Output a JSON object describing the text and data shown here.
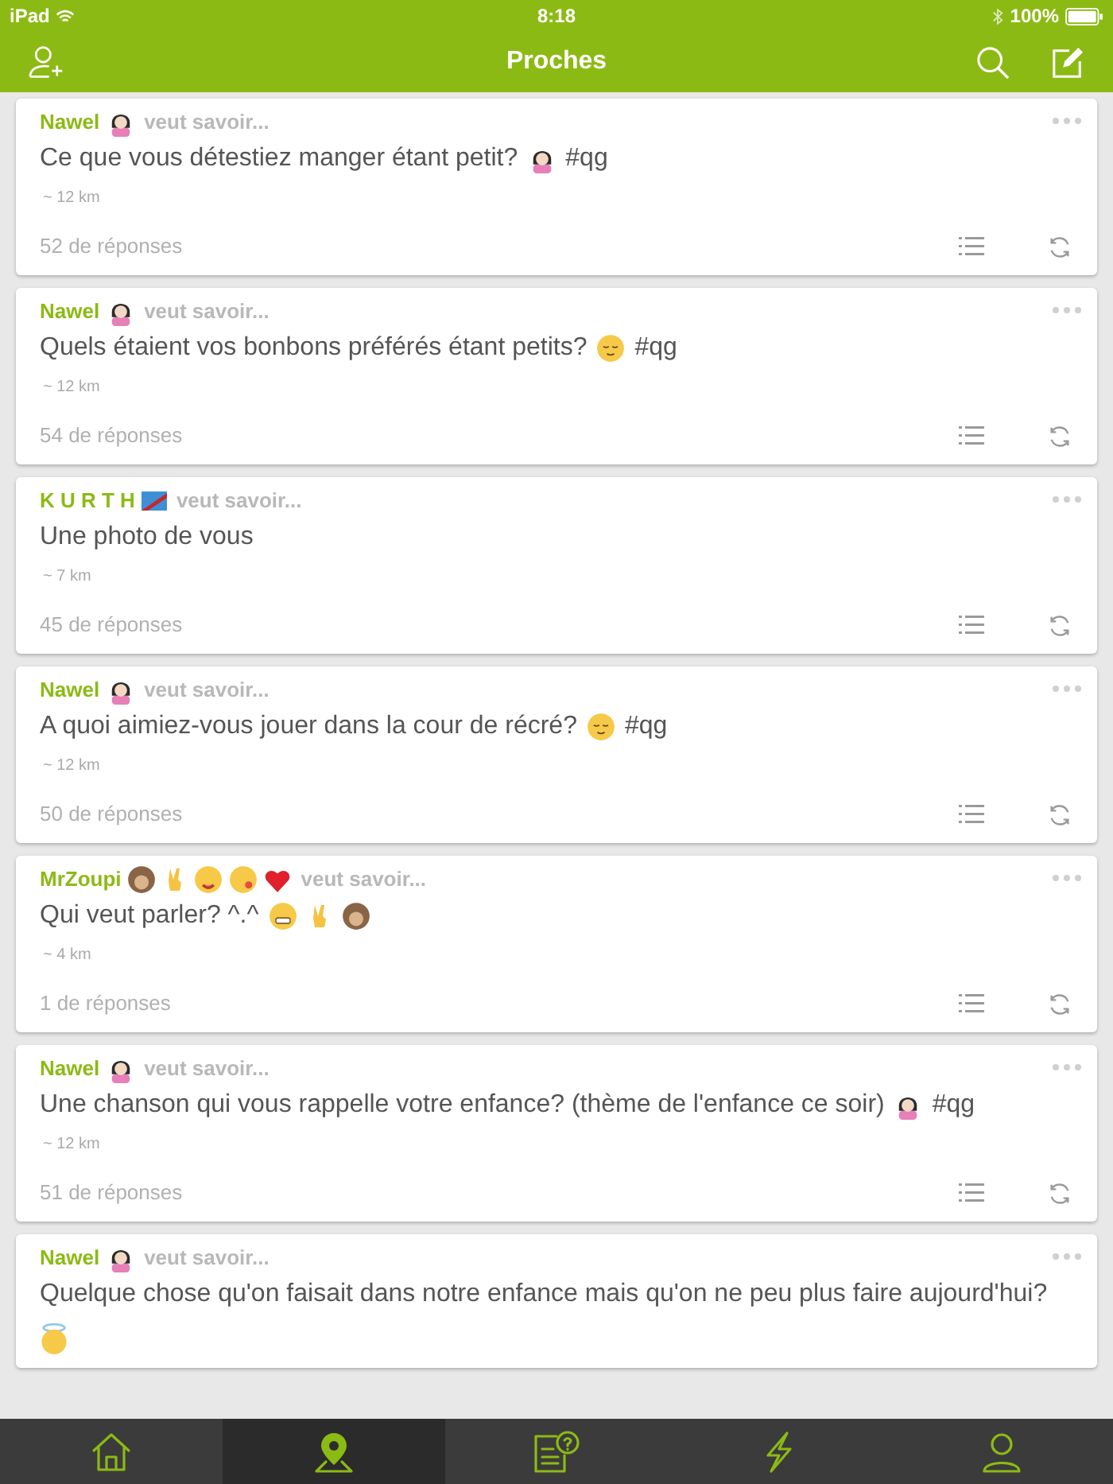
{
  "status_bar": {
    "carrier": "iPad",
    "time": "8:18",
    "battery": "100%"
  },
  "header": {
    "title": "Proches"
  },
  "questions": [
    {
      "author": "Nawel",
      "author_emojis": [
        {
          "kind": "girl"
        }
      ],
      "verb": "veut savoir...",
      "text": "Ce que vous détestiez manger étant petit?",
      "emojis": [
        {
          "kind": "girl"
        }
      ],
      "tag": "#qg",
      "distance": "~ 12 km",
      "replies": "52 de réponses"
    },
    {
      "author": "Nawel",
      "author_emojis": [
        {
          "kind": "girl"
        }
      ],
      "verb": "veut savoir...",
      "text": "Quels étaient vos bonbons préférés étant petits?",
      "emojis": [
        {
          "kind": "relieved"
        }
      ],
      "tag": "#qg",
      "distance": "~ 12 km",
      "replies": "54 de réponses"
    },
    {
      "author": "K U R T H",
      "author_emojis": [
        {
          "kind": "flag"
        }
      ],
      "verb": "veut savoir...",
      "text": "Une photo de vous",
      "distance": "~ 7 km",
      "replies": "45 de réponses"
    },
    {
      "author": "Nawel",
      "author_emojis": [
        {
          "kind": "girl"
        }
      ],
      "verb": "veut savoir...",
      "text": "A quoi aimiez-vous jouer dans la cour de récré?",
      "emojis": [
        {
          "kind": "relieved"
        }
      ],
      "tag": "#qg",
      "distance": "~ 12 km",
      "replies": "50 de réponses"
    },
    {
      "author": "MrZoupi",
      "author_emojis": [
        {
          "kind": "monkey"
        },
        {
          "kind": "victory"
        },
        {
          "kind": "wink"
        },
        {
          "kind": "kiss"
        },
        {
          "kind": "heart"
        }
      ],
      "verb": "veut savoir...",
      "text": "Qui veut parler? ^.^",
      "emojis": [
        {
          "kind": "grin"
        },
        {
          "kind": "victory"
        },
        {
          "kind": "monkey"
        }
      ],
      "distance": "~ 4 km",
      "replies": "1 de réponses"
    },
    {
      "author": "Nawel",
      "author_emojis": [
        {
          "kind": "girl"
        }
      ],
      "verb": "veut savoir...",
      "text": "Une chanson qui vous rappelle votre enfance? (thème de l'enfance ce soir)",
      "emojis": [
        {
          "kind": "girl"
        }
      ],
      "tag": "#qg",
      "distance": "~ 12 km",
      "replies": "51 de réponses"
    },
    {
      "author": "Nawel",
      "author_emojis": [
        {
          "kind": "girl"
        }
      ],
      "verb": "veut savoir...",
      "text": "Quelque chose qu'on faisait dans notre enfance mais qu'on ne peu plus faire aujourd'hui?",
      "emojis": [
        {
          "kind": "angel"
        }
      ]
    }
  ],
  "tab_bar": [
    {
      "kind": "home",
      "selected": false
    },
    {
      "kind": "nearby",
      "selected": true
    },
    {
      "kind": "questions",
      "selected": false
    },
    {
      "kind": "activity",
      "selected": false
    },
    {
      "kind": "profile",
      "selected": false
    }
  ]
}
